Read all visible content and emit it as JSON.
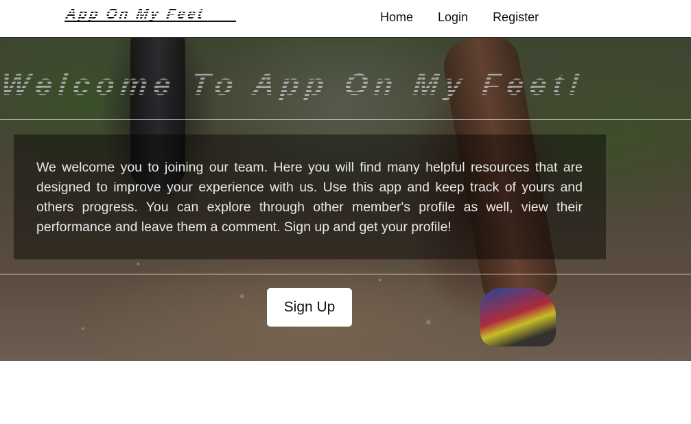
{
  "navbar": {
    "logo_text": "App On My Feet",
    "links": [
      {
        "label": "Home"
      },
      {
        "label": "Login"
      },
      {
        "label": "Register"
      }
    ]
  },
  "hero": {
    "title": "Welcome To App On My Feet!",
    "welcome_text": "We welcome you to joining our team. Here you will find many helpful resources that are designed to improve your experience with us. Use this app and keep track of yours and others progress. You can explore through other member's profile as well, view their performance and leave them a comment. Sign up and get your profile!",
    "signup_label": "Sign Up",
    "background_image": "trail-runner-photo"
  },
  "colors": {
    "navbar_bg": "#ffffff",
    "text_dark": "#111111",
    "overlay": "rgba(0,0,0,0.42)",
    "button_bg": "#ffffff"
  }
}
